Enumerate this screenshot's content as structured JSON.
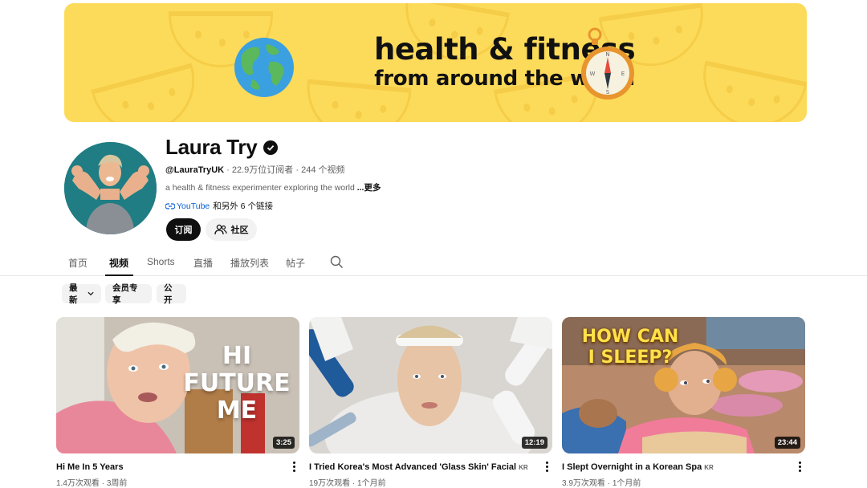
{
  "banner": {
    "line1": "health & fitness",
    "line2": "from around the world",
    "compass_letters": [
      "N",
      "E",
      "S",
      "W"
    ]
  },
  "channel": {
    "name": "Laura Try",
    "handle": "@LauraTryUK",
    "subscribers": "22.9万位订阅者",
    "video_count": "244 个视频",
    "separator": "·",
    "description": "a health & fitness experimenter exploring the world",
    "more_label": "...更多",
    "link_site": "YouTube",
    "link_extra": "和另外 6 个链接",
    "subscribe_label": "订阅",
    "community_label": "社区"
  },
  "tabs": [
    {
      "label": "首页"
    },
    {
      "label": "视频"
    },
    {
      "label": "Shorts"
    },
    {
      "label": "直播"
    },
    {
      "label": "播放列表"
    },
    {
      "label": "帖子"
    }
  ],
  "active_tab": "视频",
  "filters": [
    {
      "label": "最新"
    },
    {
      "label": "会员专享"
    },
    {
      "label": "公开"
    }
  ],
  "videos": [
    {
      "title": "Hi Me In 5 Years",
      "badge": "",
      "views": "1.4万次观看",
      "age": "3周前",
      "duration": "3:25",
      "thumb_lines": [
        "HI",
        "FUTURE",
        "ME"
      ]
    },
    {
      "title": "I Tried Korea's Most Advanced 'Glass Skin' Facial",
      "badge": "KR",
      "views": "19万次观看",
      "age": "1个月前",
      "duration": "12:19",
      "thumb_lines": []
    },
    {
      "title": "I Slept Overnight in a Korean Spa",
      "badge": "KR",
      "views": "3.9万次观看",
      "age": "1个月前",
      "duration": "23:44",
      "thumb_lines": [
        "HOW CAN",
        "I SLEEP?"
      ]
    }
  ],
  "colors": {
    "banner_bg": "#fddb5a",
    "text_primary": "#0f0f0f",
    "text_secondary": "#606060",
    "link_blue": "#065fd4",
    "chip_bg": "#f2f2f2"
  }
}
